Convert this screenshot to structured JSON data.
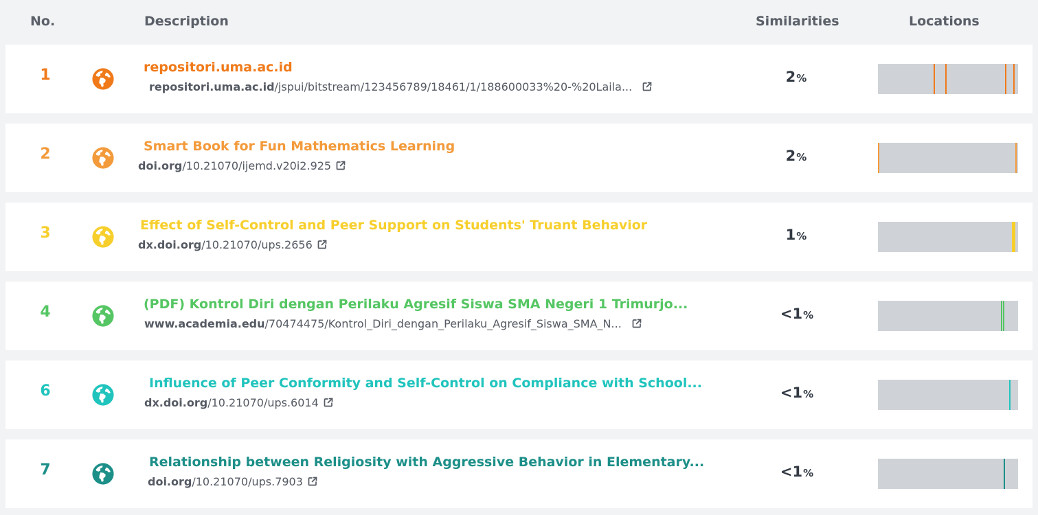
{
  "header": {
    "no": "No.",
    "description": "Description",
    "similarities": "Similarities",
    "locations": "Locations"
  },
  "rows": [
    {
      "no": "1",
      "color": "#f07a1a",
      "title": "repositori.uma.ac.id",
      "url_domain": "repositori.uma.ac.id",
      "url_path": "/jspui/bitstream/123456789/18461/1/188600033%20-%20Laila...",
      "similarity": "2",
      "similarity_unit": "%",
      "location_marks": [
        0.4,
        0.485,
        0.915,
        0.975
      ]
    },
    {
      "no": "2",
      "color": "#f39a3a",
      "title": "Smart Book for Fun Mathematics Learning",
      "url_domain": "doi.org",
      "url_path": "/10.21070/ijemd.v20i2.925",
      "similarity": "2",
      "similarity_unit": "%",
      "location_marks": [
        0.0,
        0.99
      ]
    },
    {
      "no": "3",
      "color": "#f7cf2c",
      "title": "Effect of Self-Control and Peer Support on Students' Truant Behavior",
      "url_domain": "dx.doi.org",
      "url_path": "/10.21070/ups.2656",
      "similarity": "1",
      "similarity_unit": "%",
      "location_marks": [
        0.98
      ]
    },
    {
      "no": "4",
      "color": "#55c663",
      "title": "(PDF) Kontrol Diri dengan Perilaku Agresif Siswa SMA Negeri 1 Trimurjo...",
      "url_domain": "www.academia.edu",
      "url_path": "/70474475/Kontrol_Diri_dengan_Perilaku_Agresif_Siswa_SMA_N...",
      "similarity": "<1",
      "similarity_unit": "%",
      "location_marks": [
        0.885,
        0.9
      ]
    },
    {
      "no": "6",
      "color": "#20c4bd",
      "title": "Influence of Peer Conformity and Self-Control on Compliance with School...",
      "url_domain": "dx.doi.org",
      "url_path": "/10.21070/ups.6014",
      "similarity": "<1",
      "similarity_unit": "%",
      "location_marks": [
        0.945
      ]
    },
    {
      "no": "7",
      "color": "#1c8f88",
      "title": "Relationship between Religiosity with Aggressive Behavior in Elementary...",
      "url_domain": "doi.org",
      "url_path": "/10.21070/ups.7903",
      "similarity": "<1",
      "similarity_unit": "%",
      "location_marks": [
        0.905
      ]
    }
  ],
  "icons": {
    "source": "globe-icon",
    "link": "external-link-icon"
  }
}
